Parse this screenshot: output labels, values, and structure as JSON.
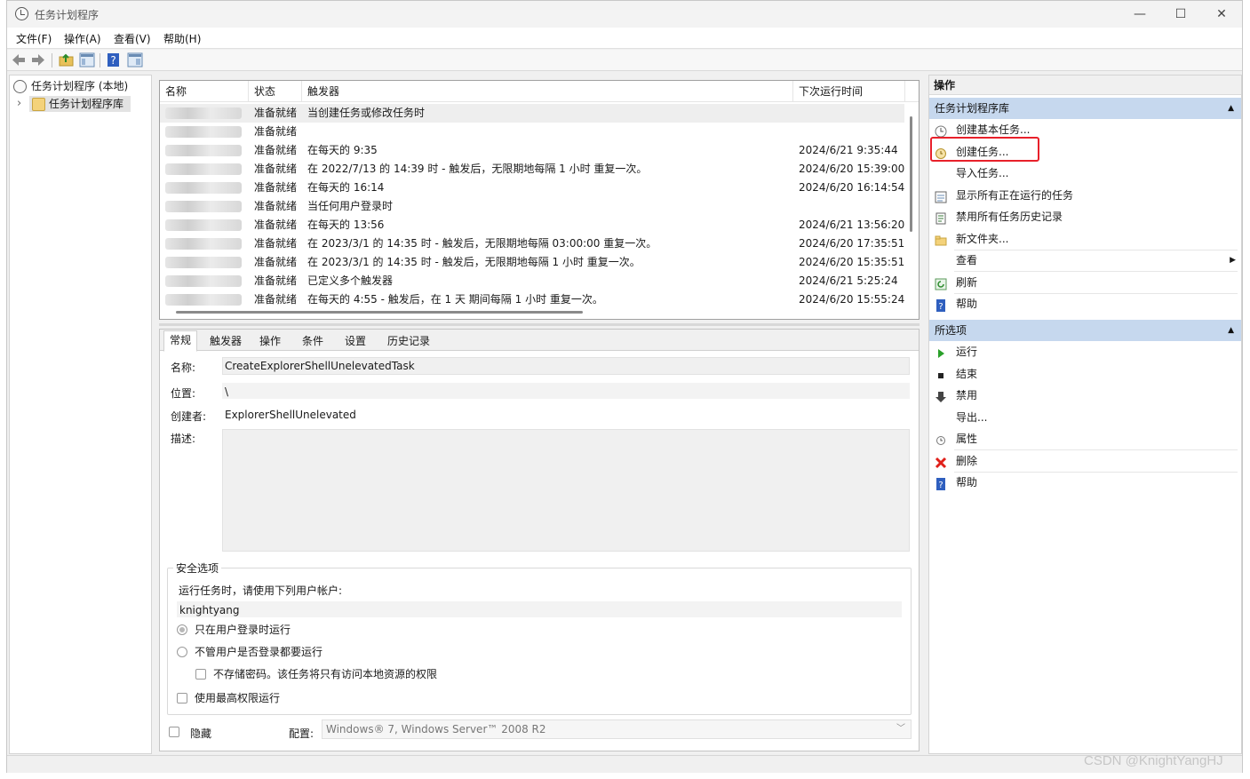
{
  "window": {
    "title": "任务计划程序",
    "minimize": "—",
    "maximize": "☐",
    "close": "✕"
  },
  "menu": [
    "文件(F)",
    "操作(A)",
    "查看(V)",
    "帮助(H)"
  ],
  "tree": {
    "root": "任务计划程序 (本地)",
    "child": "任务计划程序库",
    "expander": "›"
  },
  "task_list": {
    "columns": [
      "名称",
      "状态",
      "触发器",
      "下次运行时间"
    ],
    "rows": [
      {
        "status": "准备就绪",
        "trigger": "当创建任务或修改任务时",
        "next": ""
      },
      {
        "status": "准备就绪",
        "trigger": "",
        "next": ""
      },
      {
        "status": "准备就绪",
        "trigger": "在每天的 9:35",
        "next": "2024/6/21 9:35:44"
      },
      {
        "status": "准备就绪",
        "trigger": "在 2022/7/13 的 14:39 时 - 触发后，无限期地每隔 1 小时 重复一次。",
        "next": "2024/6/20 15:39:00"
      },
      {
        "status": "准备就绪",
        "trigger": "在每天的 16:14",
        "next": "2024/6/20 16:14:54"
      },
      {
        "status": "准备就绪",
        "trigger": "当任何用户登录时",
        "next": ""
      },
      {
        "status": "准备就绪",
        "trigger": "在每天的 13:56",
        "next": "2024/6/21 13:56:20"
      },
      {
        "status": "准备就绪",
        "trigger": "在 2023/3/1 的 14:35 时 - 触发后，无限期地每隔 03:00:00 重复一次。",
        "next": "2024/6/20 17:35:51"
      },
      {
        "status": "准备就绪",
        "trigger": "在 2023/3/1 的 14:35 时 - 触发后，无限期地每隔 1 小时 重复一次。",
        "next": "2024/6/20 15:35:51"
      },
      {
        "status": "准备就绪",
        "trigger": "已定义多个触发器",
        "next": "2024/6/21 5:25:24"
      },
      {
        "status": "准备就绪",
        "trigger": "在每天的 4:55 - 触发后，在 1 天 期间每隔 1 小时 重复一次。",
        "next": "2024/6/20 15:55:24"
      }
    ]
  },
  "detail": {
    "tabs": [
      "常规",
      "触发器",
      "操作",
      "条件",
      "设置",
      "历史记录"
    ],
    "name_label": "名称:",
    "name_value": "CreateExplorerShellUnelevatedTask",
    "location_label": "位置:",
    "location_value": "\\",
    "author_label": "创建者:",
    "author_value": "ExplorerShellUnelevated",
    "desc_label": "描述:",
    "security_title": "安全选项",
    "run_as_label": "运行任务时，请使用下列用户帐户:",
    "user": "knightyang",
    "opt_logged_on": "只在用户登录时运行",
    "opt_whether_logged": "不管用户是否登录都要运行",
    "opt_no_password": "不存储密码。该任务将只有访问本地资源的权限",
    "opt_highest": "使用最高权限运行",
    "hidden_label": "隐藏",
    "config_label": "配置:",
    "config_value": "Windows® 7, Windows Server™ 2008 R2"
  },
  "actions": {
    "header": "操作",
    "section1": "任务计划程序库",
    "items1": [
      "创建基本任务...",
      "创建任务...",
      "导入任务...",
      "显示所有正在运行的任务",
      "禁用所有任务历史记录",
      "新文件夹...",
      "查看",
      "刷新",
      "帮助"
    ],
    "section2": "所选项",
    "items2": [
      "运行",
      "结束",
      "禁用",
      "导出...",
      "属性",
      "删除",
      "帮助"
    ],
    "collapse_glyph": "▲",
    "submenu_glyph": "▶"
  },
  "watermark": "CSDN @KnightYangHJ",
  "colors": {
    "section_bg": "#c6d8ee",
    "highlight": "#e8202a",
    "selected_row": "#eeeeee"
  }
}
